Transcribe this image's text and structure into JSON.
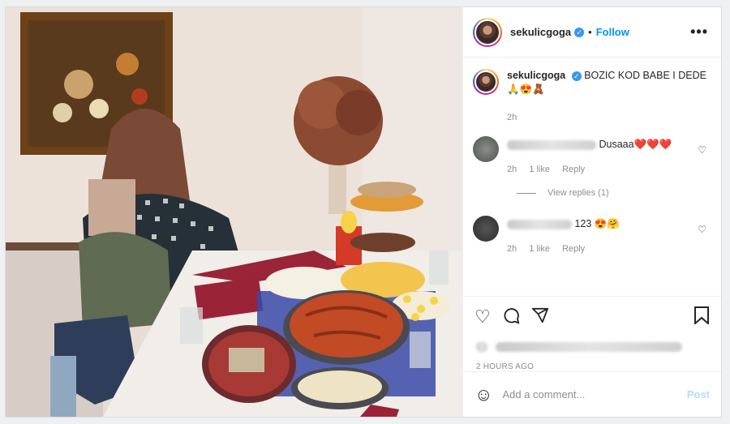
{
  "post": {
    "username": "sekulicgoga",
    "follow_label": "Follow",
    "dot": "•",
    "more_label": "•••",
    "caption": {
      "username": "sekulicgoga",
      "text": "BOZIC KOD BABE I DEDE",
      "emojis": "🙏😍🧸",
      "time": "2h"
    },
    "comments": [
      {
        "username_hidden": true,
        "text": "Dusaaa",
        "emojis": "❤️❤️❤️",
        "time": "2h",
        "likes": "1 like",
        "reply": "Reply",
        "view_replies": "View replies (1)"
      },
      {
        "username_hidden": true,
        "text": "123",
        "emojis": "😍🤗",
        "time": "2h",
        "likes": "1 like",
        "reply": "Reply"
      }
    ],
    "time_ago": "2 HOURS AGO",
    "add_comment_placeholder": "Add a comment...",
    "post_label": "Post"
  },
  "icons": {
    "verified": "verified-badge-icon",
    "heart": "heart-icon",
    "comment": "comment-icon",
    "share": "share-icon",
    "save": "bookmark-icon",
    "emoji": "emoji-icon"
  },
  "colors": {
    "accent": "#0095f6",
    "muted": "#8e8e8e",
    "border": "#efefef"
  }
}
